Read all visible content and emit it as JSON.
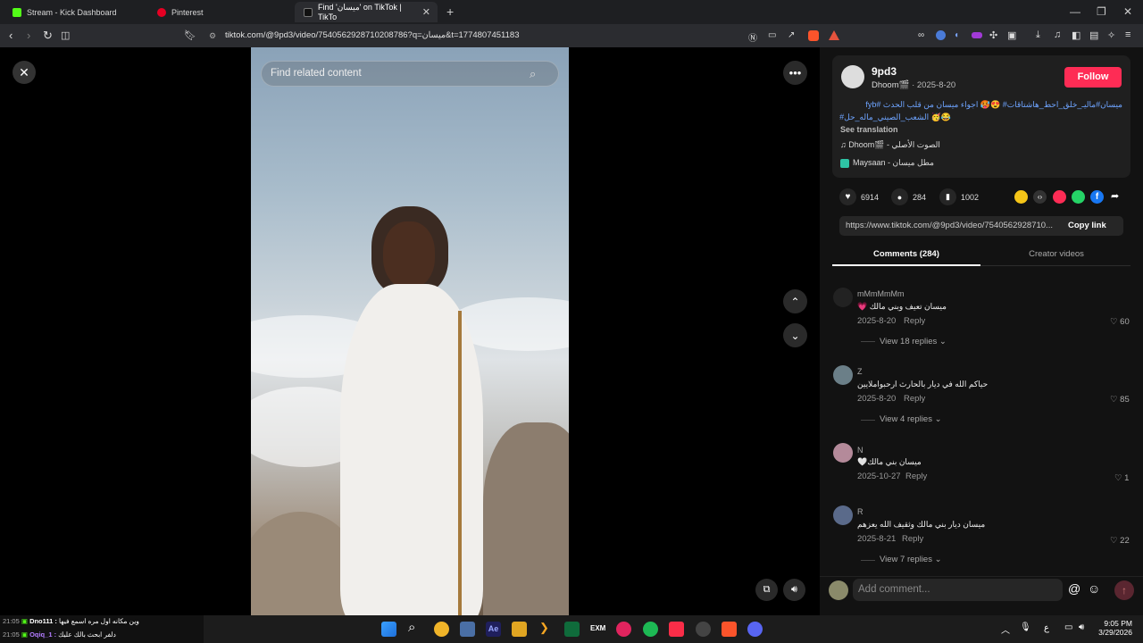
{
  "browser": {
    "tabs": [
      {
        "label": "Stream - Kick Dashboard",
        "active": false
      },
      {
        "label": "Pinterest",
        "active": false
      },
      {
        "label": "Find 'ميسان' on TikTok | TikTo",
        "active": true
      }
    ],
    "url": "tiktok.com/@9pd3/video/7540562928710208786?q=ميسان&t=1774807451183"
  },
  "video": {
    "search_placeholder": "Find related content"
  },
  "post": {
    "username": "9pd3",
    "nickname": "Dhoom🎬",
    "date": "· 2025-8-20",
    "follow_label": "Follow",
    "caption_line1": "ميسان#ماليـ_خلق_احط_هاشتاقات# 😍🥵 اجواء ميسان من قلب الحدث #fyb",
    "caption_line2": "😂🥳 الشعب_الصيني_ماله_حل#",
    "see_translation": "See translation",
    "music": "Dhoom🎬 - الصوت الأصلي",
    "place": "Maysaan - مطل ميسان",
    "likes": "6914",
    "comments_count": "284",
    "saves": "1002",
    "link": "https://www.tiktok.com/@9pd3/video/7540562928710...",
    "copy_link": "Copy link"
  },
  "panel_tabs": {
    "comments": "Comments (284)",
    "creator": "Creator videos"
  },
  "comments": [
    {
      "name": "mMmMmMm",
      "text": "ميسان تعيف وبني مالك 💗",
      "date": "2025-8-20",
      "reply": "Reply",
      "likes": "60",
      "view": "View 18 replies"
    },
    {
      "name": "Z",
      "text": "حياكم الله في ديار بالحارث ارحبواملايين",
      "date": "2025-8-20",
      "reply": "Reply",
      "likes": "85",
      "view": "View 4 replies"
    },
    {
      "name": "N",
      "text": "ميسان بني مالك🤍",
      "date": "2025-10-27",
      "reply": "Reply",
      "likes": "1",
      "view": ""
    },
    {
      "name": "R",
      "text": "ميسان ديار بني مالك وثقيف الله يعزهم",
      "date": "2025-8-21",
      "reply": "Reply",
      "likes": "22",
      "view": "View 7 replies"
    }
  ],
  "comment_input": {
    "placeholder": "Add comment..."
  },
  "chat": [
    {
      "time": "21:05",
      "user": "Dno111 :",
      "text": "وين مكانه اول مره اسمع فيها"
    },
    {
      "time": "21:05",
      "user": "Oqiq_1 :",
      "text": "دلفر ابحث بالك عليك"
    }
  ],
  "system": {
    "lang": "ع",
    "time": "9:05 PM",
    "date": "3/29/2026"
  }
}
